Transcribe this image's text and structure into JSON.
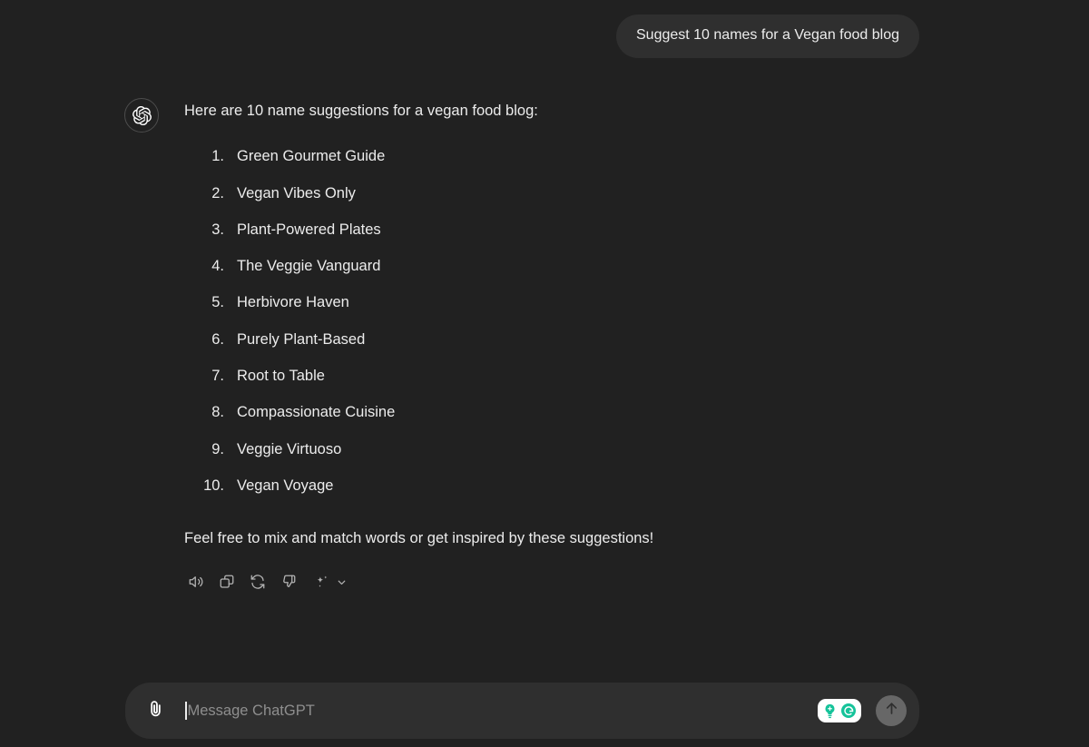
{
  "theme": {
    "page_background": "#212121",
    "bubble_background": "#2f2f2f",
    "text_primary": "#ececec",
    "text_muted": "#8e8e8e",
    "icon_color": "#b4b4b4",
    "send_button_background": "#676767",
    "grammarly_green": "#15c39a",
    "grammarly_dark_green": "#1a7f64"
  },
  "conversation": {
    "user_message": {
      "text": "Suggest 10 names for a Vegan food blog"
    },
    "assistant_message": {
      "avatar_icon": "openai-logo-icon",
      "intro": "Here are 10 name suggestions for a vegan food blog:",
      "list": [
        {
          "number": "1.",
          "name": "Green Gourmet Guide"
        },
        {
          "number": "2.",
          "name": "Vegan Vibes Only"
        },
        {
          "number": "3.",
          "name": "Plant-Powered Plates"
        },
        {
          "number": "4.",
          "name": "The Veggie Vanguard"
        },
        {
          "number": "5.",
          "name": "Herbivore Haven"
        },
        {
          "number": "6.",
          "name": "Purely Plant-Based"
        },
        {
          "number": "7.",
          "name": "Root to Table"
        },
        {
          "number": "8.",
          "name": "Compassionate Cuisine"
        },
        {
          "number": "9.",
          "name": "Veggie Virtuoso"
        },
        {
          "number": "10.",
          "name": "Vegan Voyage"
        }
      ],
      "outro": "Feel free to mix and match words or get inspired by these suggestions!",
      "actions": [
        {
          "icon": "speaker-read-aloud-icon",
          "label": "Read aloud"
        },
        {
          "icon": "copy-icon",
          "label": "Copy"
        },
        {
          "icon": "regenerate-icon",
          "label": "Regenerate"
        },
        {
          "icon": "thumbs-down-icon",
          "label": "Bad response"
        },
        {
          "icon": "sparkle-icon",
          "label": "Model switcher"
        },
        {
          "icon": "chevron-down-icon",
          "label": "More"
        }
      ]
    }
  },
  "composer": {
    "attach_icon": "paperclip-icon",
    "placeholder": "Message ChatGPT",
    "value": "",
    "grammarly": {
      "bulb_icon": "grammarly-lightbulb-icon",
      "logo_icon": "grammarly-g-icon"
    },
    "send_icon": "arrow-up-icon"
  }
}
